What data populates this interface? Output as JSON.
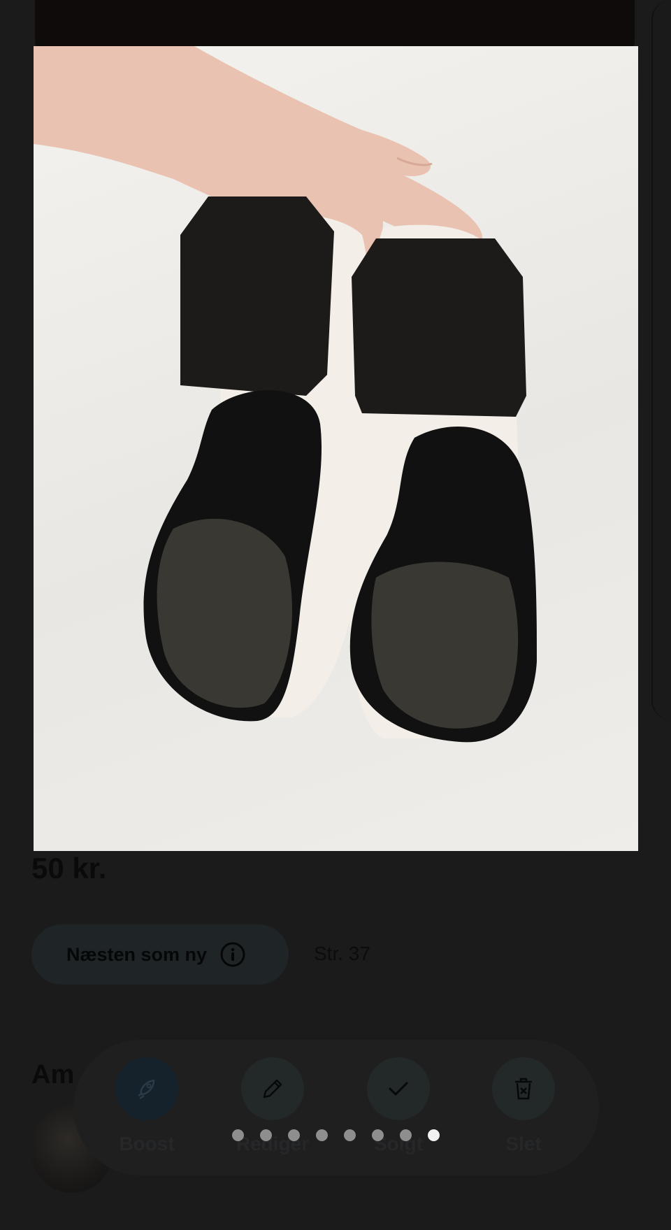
{
  "listing": {
    "price": "50 kr.",
    "condition": "Næsten som ny",
    "size": "Str. 37",
    "seller_name": "Am"
  },
  "actions": {
    "boost": "Boost",
    "edit": "Rediger",
    "sold": "Solgt",
    "delete": "Slet"
  },
  "gallery": {
    "total_images": 8,
    "current_index": 8
  },
  "icons": {
    "info": "info-icon",
    "boost": "rocket-icon",
    "edit": "pencil-icon",
    "sold": "check-icon",
    "delete": "trash-icon"
  }
}
